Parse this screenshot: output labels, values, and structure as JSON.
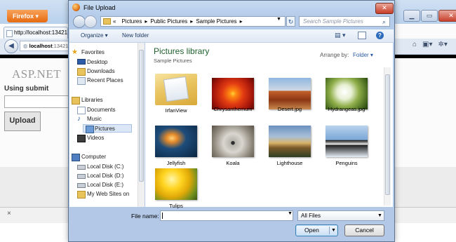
{
  "browser": {
    "app_button": "Firefox",
    "tab_title": "http://localhost:13421/",
    "url_host": "localhost",
    "url_rest": ":13421",
    "page": {
      "heading": "ASP.NET",
      "subheading": "Using submit",
      "upload_button": "Upload"
    },
    "status_close": "×"
  },
  "dialog": {
    "title": "File Upload",
    "close": "✕",
    "breadcrumb": {
      "prefix": "«",
      "items": [
        "Pictures",
        "Public Pictures",
        "Sample Pictures"
      ]
    },
    "search_placeholder": "Search Sample Pictures",
    "toolbar": {
      "organize": "Organize ▾",
      "new_folder": "New folder"
    },
    "nav": {
      "favorites": "Favorites",
      "desktop": "Desktop",
      "downloads": "Downloads",
      "recent": "Recent Places",
      "libraries": "Libraries",
      "documents": "Documents",
      "music": "Music",
      "pictures": "Pictures",
      "videos": "Videos",
      "computer": "Computer",
      "disk_c": "Local Disk (C:)",
      "disk_d": "Local Disk (D:)",
      "disk_e": "Local Disk (E:)",
      "websites": "My Web Sites on"
    },
    "library": {
      "title": "Pictures library",
      "subtitle": "Sample Pictures",
      "arrange_label": "Arrange by:",
      "arrange_value": "Folder ▾"
    },
    "files": [
      {
        "name": "IrfanView"
      },
      {
        "name": "Chrysanthemum"
      },
      {
        "name": "Desert.jpg"
      },
      {
        "name": "Hydrangeas.jpg"
      },
      {
        "name": "Jellyfish"
      },
      {
        "name": "Koala"
      },
      {
        "name": "Lighthouse"
      },
      {
        "name": "Penguins"
      },
      {
        "name": "Tulips"
      }
    ],
    "file_name_label": "File name:",
    "file_name_value": "",
    "file_type": "All Files",
    "open_button": "Open",
    "cancel_button": "Cancel"
  }
}
